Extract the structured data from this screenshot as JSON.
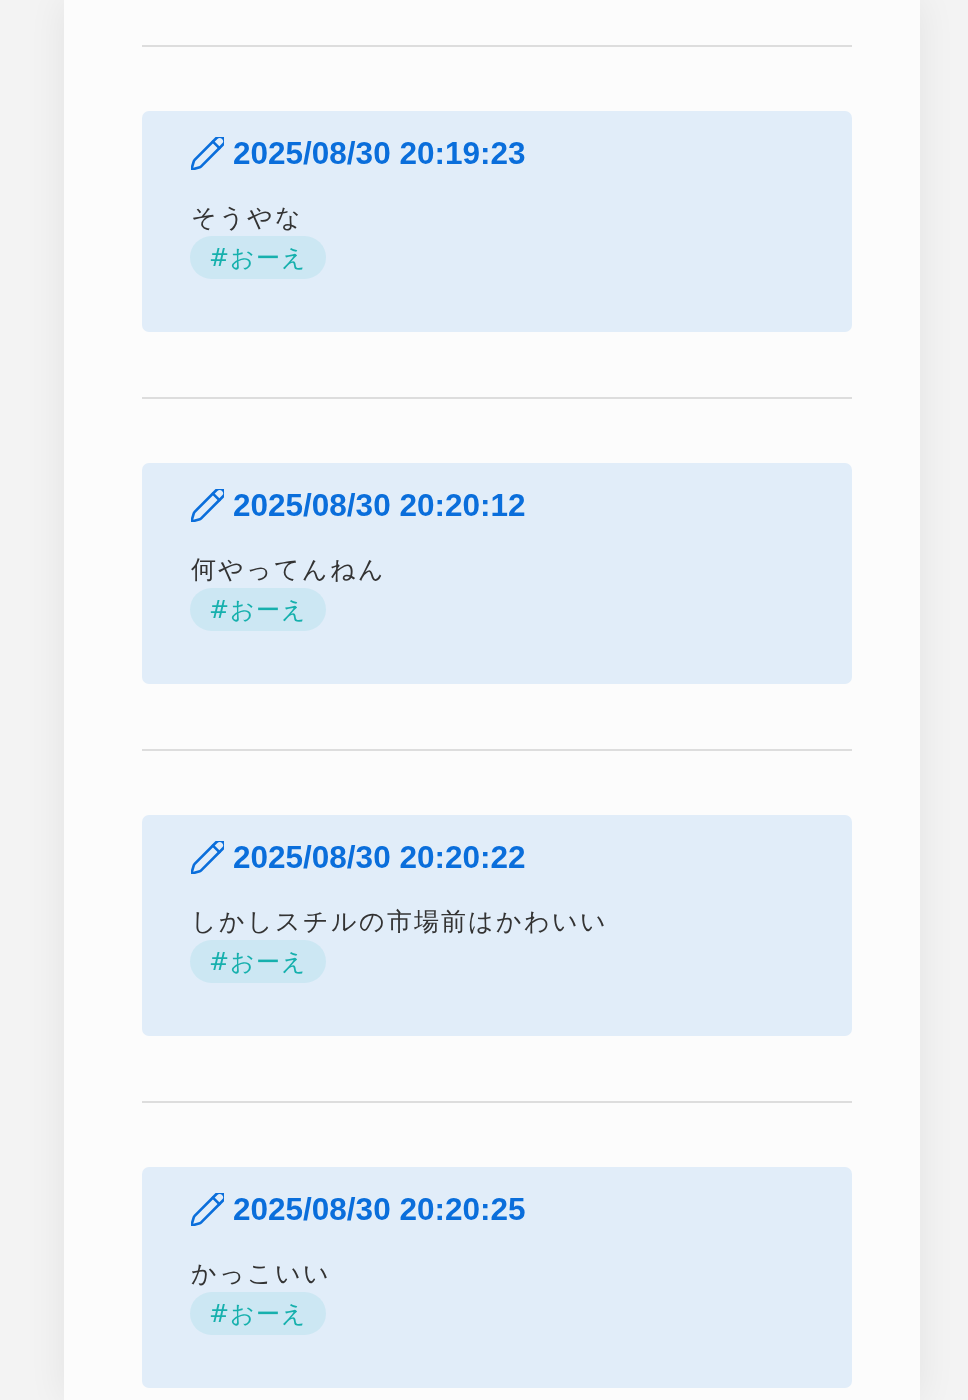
{
  "posts": [
    {
      "timestamp": "2025/08/30 20:19:23",
      "text": "そうやな",
      "tags": [
        "#おーえ"
      ]
    },
    {
      "timestamp": "2025/08/30 20:20:12",
      "text": "何やってんねん",
      "tags": [
        "#おーえ"
      ]
    },
    {
      "timestamp": "2025/08/30 20:20:22",
      "text": "しかしスチルの市場前はかわいい",
      "tags": [
        "#おーえ"
      ]
    },
    {
      "timestamp": "2025/08/30 20:20:25",
      "text": "かっこいい",
      "tags": [
        "#おーえ"
      ]
    }
  ]
}
